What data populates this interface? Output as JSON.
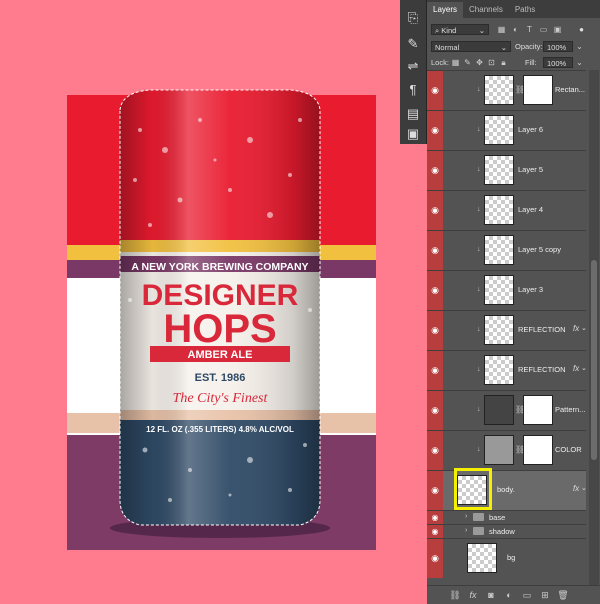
{
  "artwork": {
    "brand_line": "A NEW YORK BREWING COMPANY",
    "title_top": "DESIGNER",
    "title_bottom": "HOPS",
    "banner": "AMBER ALE",
    "established": "EST. 1986",
    "tagline": "The City's Finest",
    "volume": "12 FL. OZ (.355 LITERS) 4.8% ALC/VOL"
  },
  "panel": {
    "tabs": [
      "Layers",
      "Channels",
      "Paths"
    ],
    "filter_kind": "Kind",
    "blend_mode": "Normal",
    "opacity_label": "Opacity:",
    "opacity_value": "100%",
    "lock_label": "Lock:",
    "fill_label": "Fill:",
    "fill_value": "100%"
  },
  "layers": [
    {
      "name": "Rectan...",
      "visible": true,
      "fx": false,
      "mask": true
    },
    {
      "name": "Layer 6",
      "visible": true,
      "fx": false,
      "mask": false
    },
    {
      "name": "Layer 5",
      "visible": true,
      "fx": false,
      "mask": false
    },
    {
      "name": "Layer 4",
      "visible": true,
      "fx": false,
      "mask": false
    },
    {
      "name": "Layer 5 copy",
      "visible": true,
      "fx": false,
      "mask": false
    },
    {
      "name": "Layer 3",
      "visible": true,
      "fx": false,
      "mask": false
    },
    {
      "name": "REFLECTION",
      "visible": true,
      "fx": true,
      "mask": false
    },
    {
      "name": "REFLECTION",
      "visible": true,
      "fx": true,
      "mask": false
    },
    {
      "name": "Pattern...",
      "visible": true,
      "fx": false,
      "mask": true
    },
    {
      "name": "COLOR",
      "visible": true,
      "fx": false,
      "mask": true
    },
    {
      "name": "body.",
      "visible": true,
      "fx": true,
      "mask": false,
      "selected": true
    }
  ],
  "groups": [
    {
      "name": "base"
    },
    {
      "name": "shadow"
    }
  ],
  "bottom_layer": {
    "name": "bg"
  },
  "colors": {
    "canvas_bg": "#ff7b8e",
    "can_red": "#e91b2f",
    "can_navy": "#2f4a66",
    "accent_gold": "#f2c03f",
    "highlight": "#f5ef00",
    "visibility_column": "#b83d3d"
  }
}
